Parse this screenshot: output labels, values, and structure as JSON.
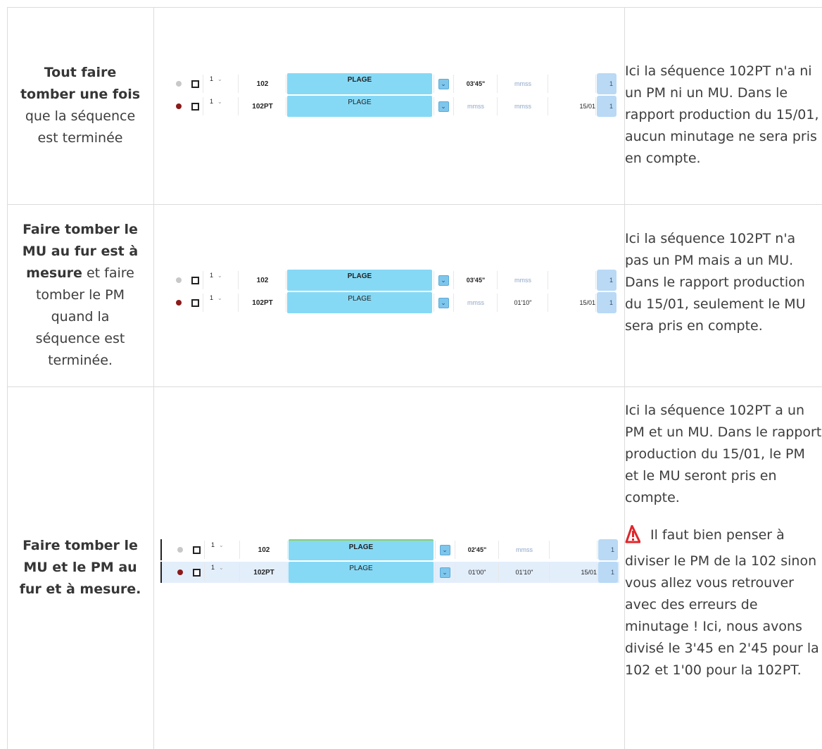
{
  "rows": [
    {
      "left_bold": "Tout faire tomber une fois",
      "left_normal": " que la séquence est terminée",
      "right_text": "Ici la séquence 102PT n'a ni un PM ni un MU. Dans le rapport production du 15/01, aucun minutage ne sera pris en compte.",
      "table": [
        {
          "dot": "grey",
          "num": "1",
          "code": "102",
          "plage": "PLAGE",
          "plage_bold": true,
          "pm": "03'45\"",
          "pm_placeholder": false,
          "mu": "mmss",
          "mu_placeholder": true,
          "date": "",
          "badge": "1",
          "highlight": false
        },
        {
          "dot": "red",
          "num": "1",
          "code": "102PT",
          "plage": "PLAGE",
          "plage_bold": false,
          "pm": "mmss",
          "pm_placeholder": true,
          "mu": "mmss",
          "mu_placeholder": true,
          "date": "15/01",
          "badge": "1",
          "highlight": false
        }
      ]
    },
    {
      "left_bold": "Faire tomber le MU au fur est à mesure",
      "left_normal": " et faire tomber le PM quand la séquence est terminée.",
      "right_text": "Ici la séquence 102PT n'a pas un PM mais a un MU. Dans le rapport production du 15/01, seulement le MU sera pris en compte.",
      "table": [
        {
          "dot": "grey",
          "num": "1",
          "code": "102",
          "plage": "PLAGE",
          "plage_bold": true,
          "pm": "03'45\"",
          "pm_placeholder": false,
          "mu": "mmss",
          "mu_placeholder": true,
          "date": "",
          "badge": "1",
          "highlight": false
        },
        {
          "dot": "red",
          "num": "1",
          "code": "102PT",
          "plage": "PLAGE",
          "plage_bold": false,
          "pm": "mmss",
          "pm_placeholder": true,
          "mu": "01'10\"",
          "mu_placeholder": false,
          "date": "15/01",
          "badge": "1",
          "highlight": false
        }
      ]
    },
    {
      "left_bold": "Faire tomber le MU et le PM au fur et à mesure.",
      "left_normal": "",
      "right_text": "Ici la séquence 102PT a un PM et un MU. Dans le rapport production du 15/01, le PM et le MU seront pris en compte.",
      "warning_text": "Il faut bien penser à diviser le PM de la 102 sinon vous allez vous retrouver avec des erreurs de minutage ! Ici, nous avons divisé le 3'45 en 2'45 pour la 102 et 1'00 pour la 102PT.",
      "warning_icon": "warning-triangle-icon",
      "warning_color": "#e0262b",
      "table": [
        {
          "dot": "grey",
          "num": "1",
          "code": "102",
          "plage": "PLAGE",
          "plage_bold": true,
          "pm": "02'45\"",
          "pm_placeholder": false,
          "mu": "mmss",
          "mu_placeholder": true,
          "date": "",
          "badge": "1",
          "highlight": false
        },
        {
          "dot": "red",
          "num": "1",
          "code": "102PT",
          "plage": "PLAGE",
          "plage_bold": false,
          "pm": "01'00\"",
          "pm_placeholder": false,
          "mu": "01'10\"",
          "mu_placeholder": false,
          "date": "15/01",
          "badge": "1",
          "highlight": true
        }
      ]
    }
  ],
  "colors": {
    "plage": "#86d9f5",
    "badge": "#b9d9f5",
    "dot_red": "#8b1a1a",
    "dot_grey": "#c8c8c8",
    "placeholder": "#8fa6c8",
    "row_highlight": "#e3eefb"
  }
}
